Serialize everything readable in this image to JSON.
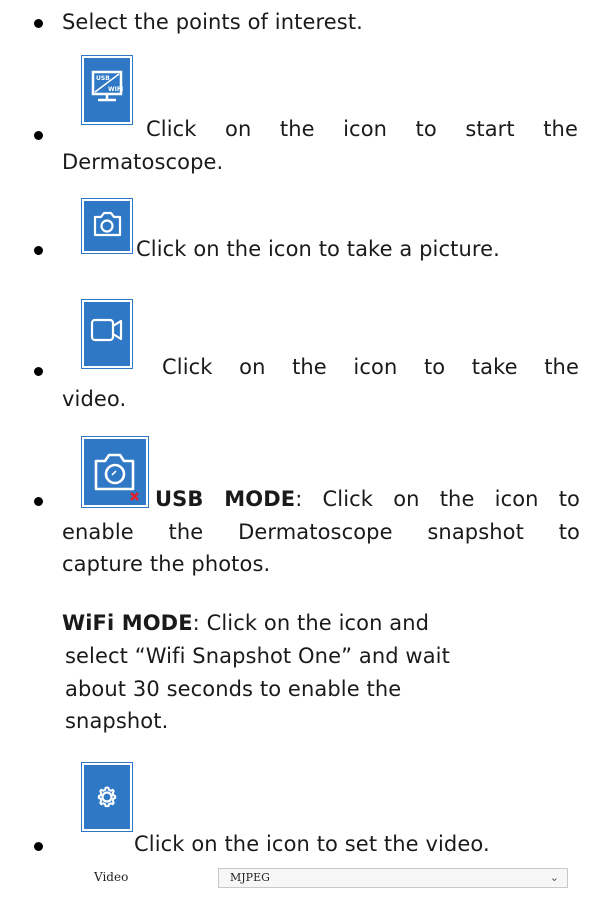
{
  "items": [
    {
      "text": "Select the points of interest."
    },
    {
      "icon": "usb-wifi-monitor-icon",
      "text_line1": "Click on the icon to start the",
      "text_line2": "Dermatoscope."
    },
    {
      "icon": "camera-icon",
      "text": "Click on the icon to take a picture."
    },
    {
      "icon": "video-camera-icon",
      "text_line1": "Click on the icon to take the",
      "text_line2": "video."
    },
    {
      "icon": "camera-disabled-icon",
      "mode_label": "USB MODE",
      "text_line1": ": Click on the icon to",
      "text_line2": "enable the Dermatoscope snapshot to",
      "text_line3": "capture the photos.",
      "wifi_label": "WiFi MODE",
      "wifi_line1": ": Click on the icon and",
      "wifi_line2": "select “Wifi Snapshot One” and wait",
      "wifi_line3": "about 30 seconds  to enable the",
      "wifi_line4": "snapshot."
    },
    {
      "icon": "gear-icon",
      "text": "Click on the icon to set the video."
    }
  ],
  "icon_labels": {
    "usb": "USB",
    "wifi": "WIFI"
  },
  "setting": {
    "label": "Video",
    "value": "MJPEG"
  },
  "colors": {
    "icon_blue": "#2e78c6",
    "error_red": "#e0202a"
  }
}
